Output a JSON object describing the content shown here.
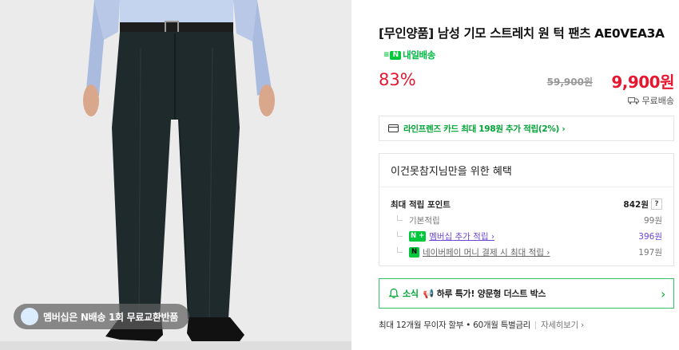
{
  "image": {
    "badge_text": "멤버십은 N배송 1회 무료교환반품"
  },
  "product": {
    "title": "[무인양품] 남성 기모 스트레치 원 턱 팬츠 AE0VEA3A",
    "delivery_badge": "내일배송",
    "discount": "83%",
    "original_price": "59,900원",
    "sale_price": "9,900원",
    "shipping": "무료배송"
  },
  "card_promo": {
    "text": "라인프렌즈 카드 최대 198원 추가 적립(2%) ›"
  },
  "benefit": {
    "title": "이건못참지님만을 위한 혜택",
    "max_points_label": "최대 적립 포인트",
    "max_points_value": "842원",
    "help": "?",
    "items": [
      {
        "label": "기본적립",
        "value": "99원"
      },
      {
        "badge": "N +",
        "label": "멤버십 추가 적립 ›",
        "value": "396원"
      },
      {
        "badge": "N",
        "label": "네이버페이 머니 결제 시 최대 적립 ›",
        "value": "197원"
      }
    ]
  },
  "news": {
    "tag": "소식",
    "text": "📢 하루 특가! 양문형 더스트 박스",
    "chevron": "›"
  },
  "installment": {
    "text": "최대 12개월 무이자 할부 • 60개월 특별금리",
    "more": "자세히보기 ›"
  },
  "colors": {
    "accent_red": "#e5162f",
    "naver_green": "#00c73c",
    "link_purple": "#6a45d6"
  }
}
